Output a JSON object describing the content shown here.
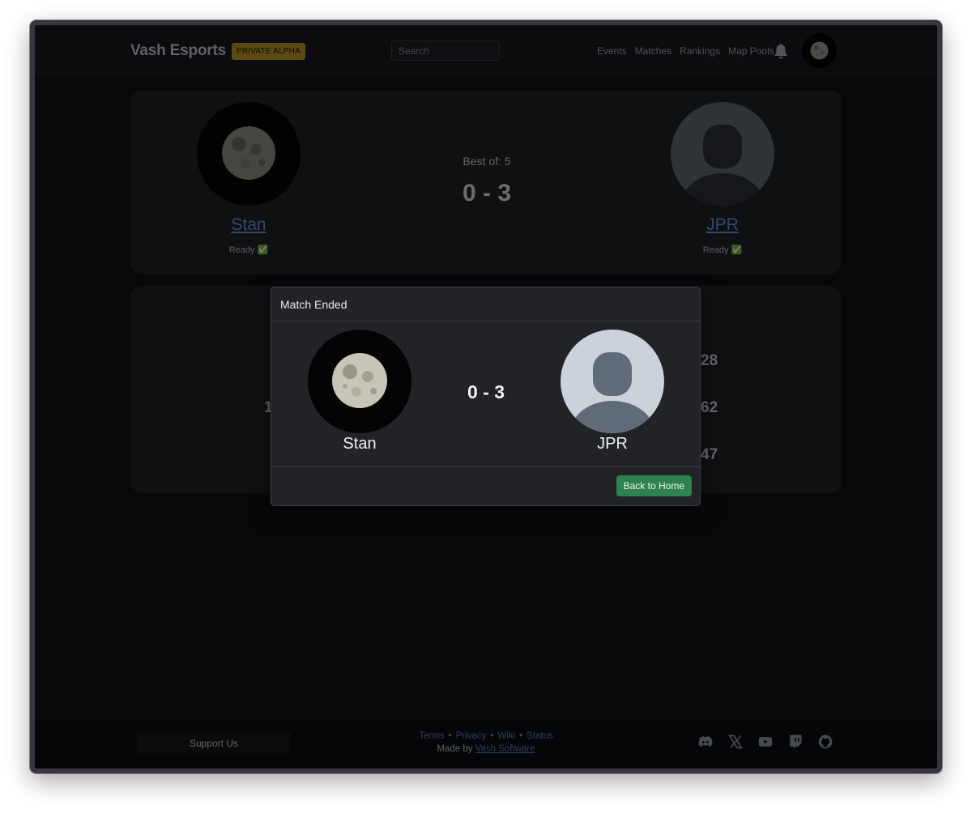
{
  "navbar": {
    "brand": "Vash Esports",
    "badge": "PRIVATE ALPHA",
    "search_placeholder": "Search",
    "links": [
      "Events",
      "Matches",
      "Rankings",
      "Map Pools"
    ]
  },
  "match": {
    "player1": {
      "name": "Stan",
      "status": "Ready ✅"
    },
    "player2": {
      "name": "JPR",
      "status": "Ready ✅"
    },
    "best_of": "Best of: 5",
    "score": "0 - 3"
  },
  "games": {
    "left_partial": "1",
    "right_partials": [
      "28",
      "62",
      "47"
    ]
  },
  "modal": {
    "title": "Match Ended",
    "player1": "Stan",
    "player2": "JPR",
    "score": "0 - 3",
    "button": "Back to Home"
  },
  "footer": {
    "support": "Support Us",
    "links": [
      "Terms",
      "Privacy",
      "Wiki",
      "Status"
    ],
    "separator": "•",
    "made_by_prefix": "Made by",
    "made_by_link": "Vash Software",
    "socials": [
      "discord-icon",
      "x-icon",
      "youtube-icon",
      "twitch-icon",
      "github-icon"
    ]
  },
  "colors": {
    "accent_link": "#6f8fd9",
    "badge": "#b89022",
    "success_button": "#2d8250",
    "page_bg": "#101114"
  }
}
